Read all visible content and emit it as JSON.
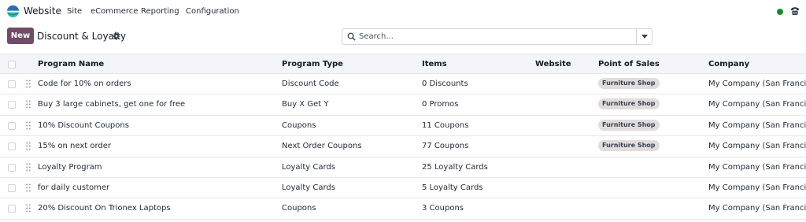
{
  "navbar": {
    "app_name": "Website",
    "menu": [
      "Site",
      "eCommerce",
      "Reporting",
      "Configuration"
    ],
    "status_color": "#1a8a2e"
  },
  "control_panel": {
    "new_label": "New",
    "title": "Discount & Loyalty",
    "search_placeholder": "Search..."
  },
  "colors": {
    "brand": "#714b67",
    "tag_bg": "#e3dcdc",
    "header_bg": "#f3f5f9"
  },
  "table": {
    "columns": [
      "Program Name",
      "Program Type",
      "Items",
      "Website",
      "Point of Sales",
      "Company"
    ],
    "rows": [
      {
        "name": "Code for 10% on orders",
        "type": "Discount Code",
        "items": "0 Discounts",
        "website": "",
        "pos": "Furniture Shop",
        "company": "My Company (San Francisco)"
      },
      {
        "name": "Buy 3 large cabinets, get one for free",
        "type": "Buy X Get Y",
        "items": "0 Promos",
        "website": "",
        "pos": "Furniture Shop",
        "company": "My Company (San Francisco)"
      },
      {
        "name": "10% Discount Coupons",
        "type": "Coupons",
        "items": "11 Coupons",
        "website": "",
        "pos": "Furniture Shop",
        "company": "My Company (San Francisco)"
      },
      {
        "name": "15% on next order",
        "type": "Next Order Coupons",
        "items": "77 Coupons",
        "website": "",
        "pos": "Furniture Shop",
        "company": "My Company (San Francisco)"
      },
      {
        "name": "Loyalty Program",
        "type": "Loyalty Cards",
        "items": "25 Loyalty Cards",
        "website": "",
        "pos": "",
        "company": "My Company (San Francisco)"
      },
      {
        "name": "for daily customer",
        "type": "Loyalty Cards",
        "items": "5 Loyalty Cards",
        "website": "",
        "pos": "",
        "company": "My Company (San Francisco)"
      },
      {
        "name": "20% Discount On Trionex Laptops",
        "type": "Coupons",
        "items": "3 Coupons",
        "website": "",
        "pos": "",
        "company": "My Company (San Francisco)"
      }
    ]
  }
}
